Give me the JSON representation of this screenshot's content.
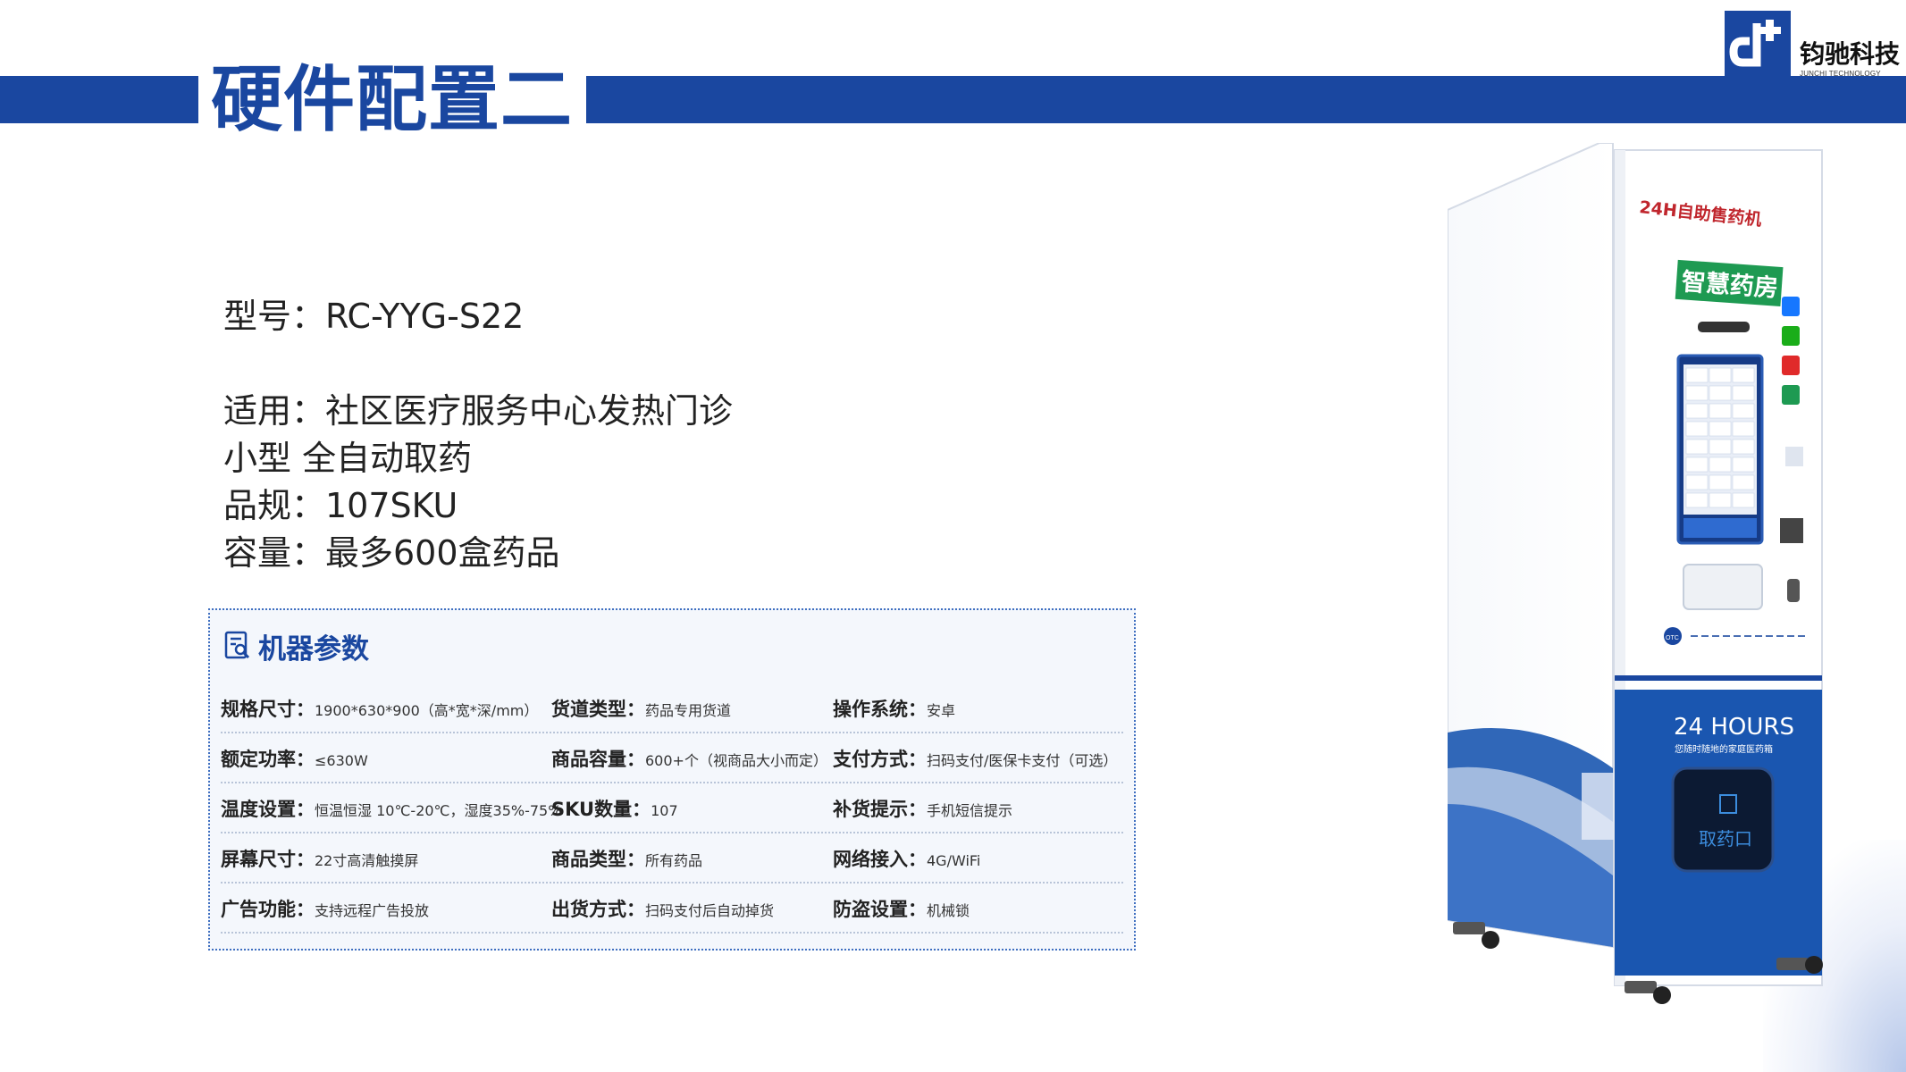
{
  "header": {
    "title": "硬件配置二",
    "logo_text": "钧驰科技",
    "logo_sub": "JUNCHI TECHNOLOGY"
  },
  "specs": [
    "型号：RC-YYG-S22",
    "适用：社区医疗服务中心发热门诊",
    "小型 全自动取药",
    "品规：107SKU",
    "容量：最多600盒药品"
  ],
  "params": {
    "title": "机器参数",
    "rows": [
      [
        {
          "label": "规格尺寸：",
          "value": "1900*630*900（高*宽*深/mm）"
        },
        {
          "label": "货道类型：",
          "value": "药品专用货道"
        },
        {
          "label": "操作系统：",
          "value": "安卓"
        }
      ],
      [
        {
          "label": "额定功率：",
          "value": "≤630W"
        },
        {
          "label": "商品容量：",
          "value": "600+个（视商品大小而定）"
        },
        {
          "label": "支付方式：",
          "value": "扫码支付/医保卡支付（可选）"
        }
      ],
      [
        {
          "label": "温度设置：",
          "value": "恒温恒湿 10℃-20℃，湿度35%-75%"
        },
        {
          "label": "SKU数量：",
          "value": "107"
        },
        {
          "label": "补货提示：",
          "value": "手机短信提示"
        }
      ],
      [
        {
          "label": "屏幕尺寸：",
          "value": "22寸高清触摸屏"
        },
        {
          "label": "商品类型：",
          "value": "所有药品"
        },
        {
          "label": "网络接入：",
          "value": "4G/WiFi"
        }
      ],
      [
        {
          "label": "广告功能：",
          "value": "支持远程广告投放"
        },
        {
          "label": "出货方式：",
          "value": "扫码支付后自动掉货"
        },
        {
          "label": "防盗设置：",
          "value": "机械锁"
        }
      ]
    ]
  },
  "machine": {
    "top_label": "24H自助售药机",
    "sign": "智慧药房",
    "panel_title": "24 HOURS",
    "panel_sub": "您随时随地的家庭医药箱",
    "pickup_label": "取药口",
    "otc": "OTC"
  },
  "colors": {
    "brand": "#1a47a0",
    "green": "#1e9a52"
  }
}
